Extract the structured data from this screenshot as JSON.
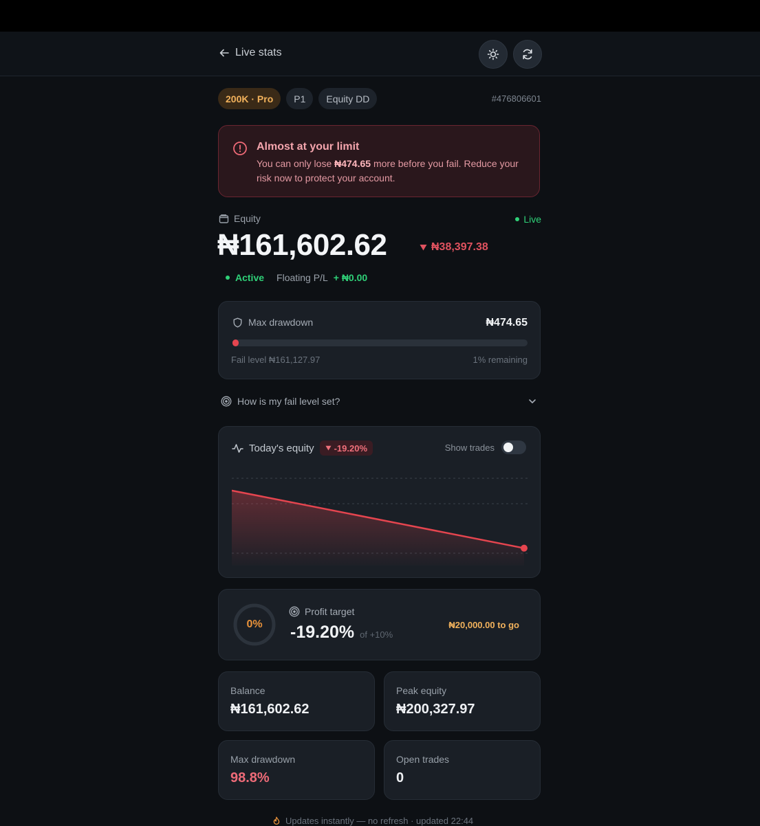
{
  "header": {
    "back_label": "Live stats"
  },
  "chips": [
    "200K · Pro",
    "P1",
    "Equity DD"
  ],
  "account_id": "#476806601",
  "alert": {
    "title": "Almost at your limit",
    "msg_pre": "You can only lose ",
    "msg_amount": "₦474.65",
    "msg_post": " more before you fail. Reduce your risk now to protect your account."
  },
  "equity": {
    "label": "Equity",
    "live": "Live",
    "value": "₦161,602.62",
    "change": "₦38,397.38",
    "status": "Active",
    "floating_label": "Floating P/L",
    "floating_value": "+ ₦0.00"
  },
  "drawdown": {
    "label": "Max drawdown",
    "value": "₦474.65",
    "fail_level": "Fail level ₦161,127.97",
    "remaining": "1% remaining",
    "remaining_fraction": 0.01
  },
  "faq": {
    "label": "How is my fail level set?"
  },
  "chart": {
    "title": "Today's equity",
    "badge": "-19.20%",
    "show_trades_label": "Show trades",
    "show_trades_on": false
  },
  "chart_data": {
    "type": "area",
    "x": [
      0,
      1
    ],
    "values": [
      200000,
      161602.62
    ],
    "ylim": [
      150000,
      215000
    ],
    "grid": true,
    "color": "#e5454f"
  },
  "profit_target": {
    "ring_label": "0%",
    "ring_fraction": 0,
    "label": "Profit target",
    "value": "-19.20%",
    "of": "of +10%",
    "to_go": "₦20,000.00 to go"
  },
  "stats": [
    {
      "label": "Balance",
      "value": "₦161,602.62"
    },
    {
      "label": "Peak equity",
      "value": "₦200,327.97"
    },
    {
      "label": "Max drawdown",
      "value": "98.8%"
    },
    {
      "label": "Open trades",
      "value": "0"
    }
  ],
  "footer": {
    "text": "Updates instantly — no refresh · updated 22:44"
  },
  "colors": {
    "danger": "#e5454f",
    "success": "#2fd178",
    "warning": "#f2b25c"
  }
}
